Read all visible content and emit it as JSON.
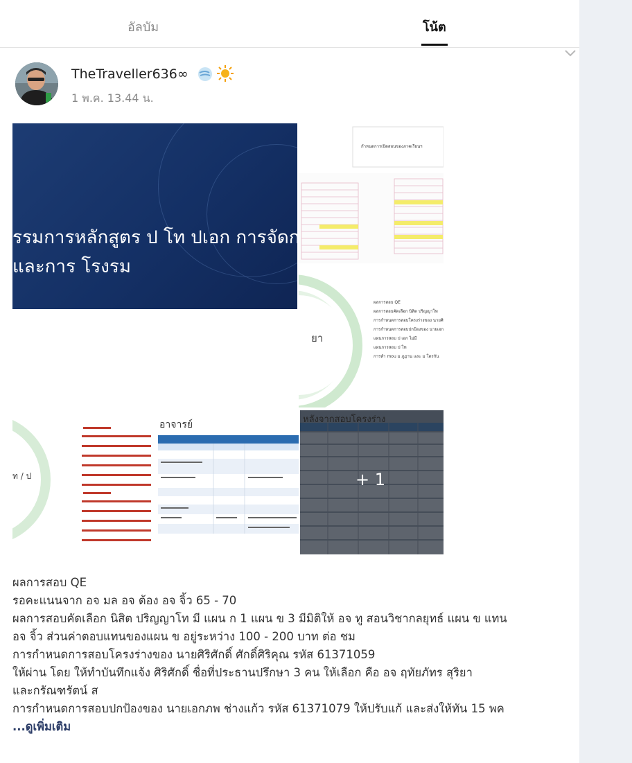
{
  "tabs": {
    "album": "อัลบัม",
    "notes": "โน้ต"
  },
  "post": {
    "author": "TheTraveller636∞",
    "emoji": [
      "🌬️",
      "☀️"
    ],
    "timestamp": "1 พ.ค. 13.44 น.",
    "photos": {
      "slide_line1": "รรมการหลักสูตร ป โท ปเอก การจัดการก",
      "slide_line2": "และการ โรงรม",
      "agenda": [
        "ผลการสอบ QE",
        "ผลการสอบคัดเลือก นิสิต ปริญญาโท",
        "การกำหนดการสอบโครงร่างของ นายศิริ",
        "การกำหนดการสอบปกป้องของ นายเอก",
        "แผนการสอบ ป เอก ไม่มี",
        "แผนการสอบ ป โท",
        "การทำ mou ม ภูฏาน และ ม โตรกัน"
      ],
      "bullet_top": "กำหนดการเปิดสอนของภาคเรียนฯ",
      "fragment_ya": "ยา",
      "fragment_ajarn": "อาจารย์",
      "fragment_tp": "ท / ป",
      "table_header": "หลังจากสอบโครงร่าง",
      "more_count": "+ 1"
    },
    "body": [
      "ผลการสอบ QE",
      "รอคะแนนจาก อจ มล อจ ต้อง อจ จิ้ว 65 - 70",
      "ผลการสอบคัดเลือก นิสิต ปริญญาโท มี แผน ก 1 แผน  ข 3 มีมิติให้ อจ ทู สอนวิชากลยุทธ์ แผน ข แทน",
      "อจ จิ้ว ส่วนค่าตอบแทนของแผน ข อยู่ระหว่าง 100 - 200 บาท ต่อ ชม",
      "การกำหนดการสอบโครงร่างของ นายศิริศักดิ์ ศักดิ์ศิริคุณ รหัส 61371059",
      "ให้ผ่าน โดย ให้ทำบันทึกแจ้ง ศิริศักดิ์ ชื่อที่ประธานปรึกษา 3 คน ให้เลือก คือ อจ ฤทัยภัทร สุริยา",
      "และกรัณฑรัตน์ ส",
      "การกำหนดการสอบปกป้องของ นายเอกภพ ช่างแก้ว รหัส 61371079  ให้ปรับแก้ และส่งให้ทัน 15 พค"
    ],
    "see_more": "...ดูเพิ่มเติม"
  }
}
